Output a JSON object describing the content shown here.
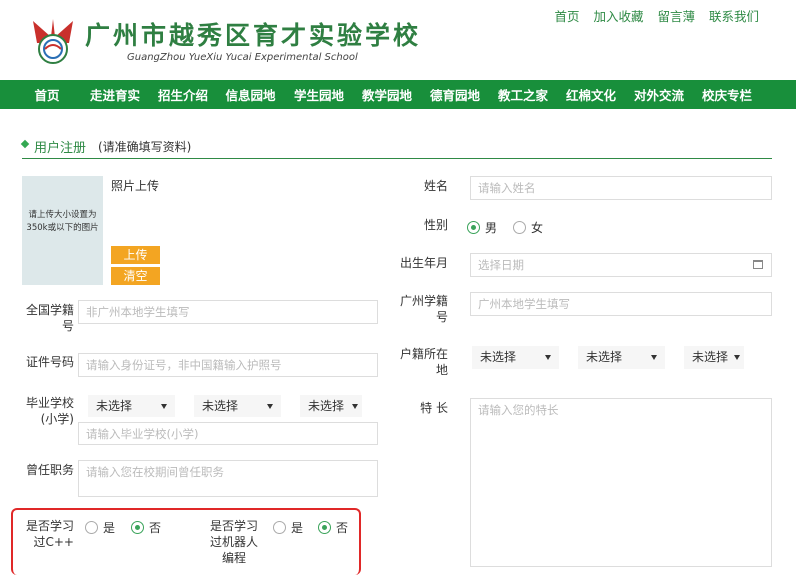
{
  "header": {
    "school_cn": "广州市越秀区育才实验学校",
    "school_en": "GuangZhou YueXiu Yucai Experimental School",
    "top_links": [
      "首页",
      "加入收藏",
      "留言薄",
      "联系我们"
    ]
  },
  "nav": {
    "items": [
      "首页",
      "走进育实",
      "招生介绍",
      "信息园地",
      "学生园地",
      "教学园地",
      "德育园地",
      "教工之家",
      "红棉文化",
      "对外交流",
      "校庆专栏"
    ]
  },
  "section": {
    "title": "用户注册",
    "hint": "(请准确填写资料)"
  },
  "photo": {
    "hint_line1": "请上传大小设置为",
    "hint_line2": "350k或以下的图片",
    "label": "照片上传",
    "upload_btn": "上传",
    "clear_btn": "清空"
  },
  "form": {
    "national_id": {
      "label_1": "全国学籍",
      "label_2": "号",
      "placeholder": "非广州本地学生填写"
    },
    "cert_no": {
      "label": "证件号码",
      "placeholder": "请输入身份证号，非中国籍输入护照号"
    },
    "grad_school": {
      "label_1": "毕业学校",
      "label_2": "(小学)",
      "select1": "未选择",
      "select2": "未选择",
      "select3": "未选择",
      "placeholder": "请输入毕业学校(小学)"
    },
    "prev_role": {
      "label": "曾任职务",
      "placeholder": "请输入您在校期间曾任职务"
    },
    "learned_cpp": {
      "label_1": "是否学习",
      "label_2": "过C++",
      "yes": "是",
      "no": "否",
      "selected": "否"
    },
    "learned_robot": {
      "label_1": "是否学习",
      "label_2": "过机器人",
      "label_3": "编程",
      "yes": "是",
      "no": "否",
      "selected": "否"
    },
    "name": {
      "label": "姓名",
      "placeholder": "请输入姓名"
    },
    "gender": {
      "label": "性别",
      "male": "男",
      "female": "女",
      "selected": "男"
    },
    "birth": {
      "label": "出生年月",
      "placeholder": "选择日期"
    },
    "gz_id": {
      "label_1": "广州学籍",
      "label_2": "号",
      "placeholder": "广州本地学生填写"
    },
    "hukou": {
      "label_1": "户籍所在",
      "label_2": "地",
      "select1": "未选择",
      "select2": "未选择",
      "select3": "未选择"
    },
    "talent": {
      "label": "特 长",
      "placeholder": "请输入您的特长"
    }
  }
}
